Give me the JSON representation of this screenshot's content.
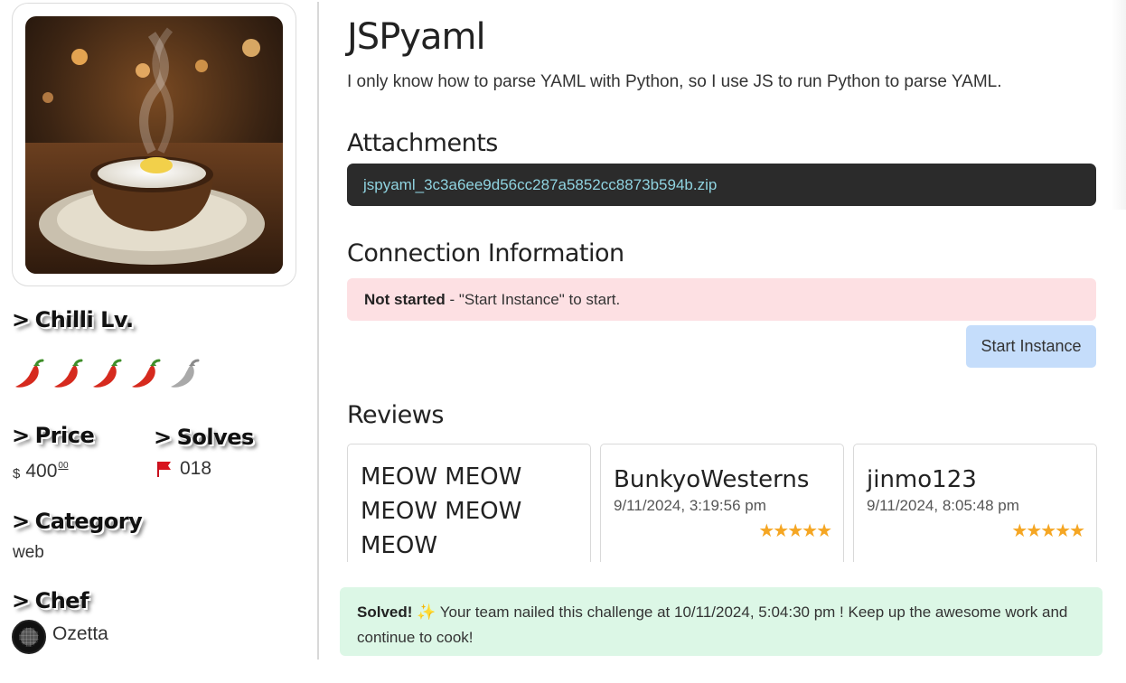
{
  "sidebar": {
    "chilli_heading": "Chilli Lv.",
    "chilli_level": 4,
    "chilli_max": 5,
    "price_heading": "Price",
    "price_currency": "$",
    "price_value": "400",
    "price_decimals": "00",
    "solves_heading": "Solves",
    "solves_value": "018",
    "category_heading": "Category",
    "category_value": "web",
    "chef_heading": "Chef",
    "chef_name": "Ozetta",
    "gt": ">"
  },
  "challenge": {
    "title": "JSPyaml",
    "description": "I only know how to parse YAML with Python, so I use JS to run Python to parse YAML."
  },
  "attachments": {
    "heading": "Attachments",
    "file": "jspyaml_3c3a6ee9d56cc287a5852cc8873b594b.zip"
  },
  "connection": {
    "heading": "Connection Information",
    "status": "Not started",
    "message": " - \"Start Instance\" to start.",
    "button_label": "Start Instance"
  },
  "reviews": {
    "heading": "Reviews",
    "items": [
      {
        "text": "MEOW MEOW MEOW MEOW MEOW"
      },
      {
        "name": "BunkyoWesterns",
        "date": "9/11/2024, 3:19:56 pm",
        "stars": "★★★★★",
        "rating": 5
      },
      {
        "name": "jinmo123",
        "date": "9/11/2024, 8:05:48 pm",
        "stars": "★★★★★",
        "rating": 5
      }
    ]
  },
  "solved": {
    "label": "Solved!",
    "emoji": "✨",
    "message": " Your team nailed this challenge at 10/11/2024, 5:04:30 pm ! Keep up the awesome work and continue to cook!"
  },
  "colors": {
    "attach_bg": "#2b2b2b",
    "attach_link": "#8fd3e0",
    "alert_bg": "#fde0e3",
    "button_bg": "#c5ddfb",
    "solved_bg": "#dcf7e6",
    "star": "#f5a623",
    "chilli": "#d62a1e"
  }
}
